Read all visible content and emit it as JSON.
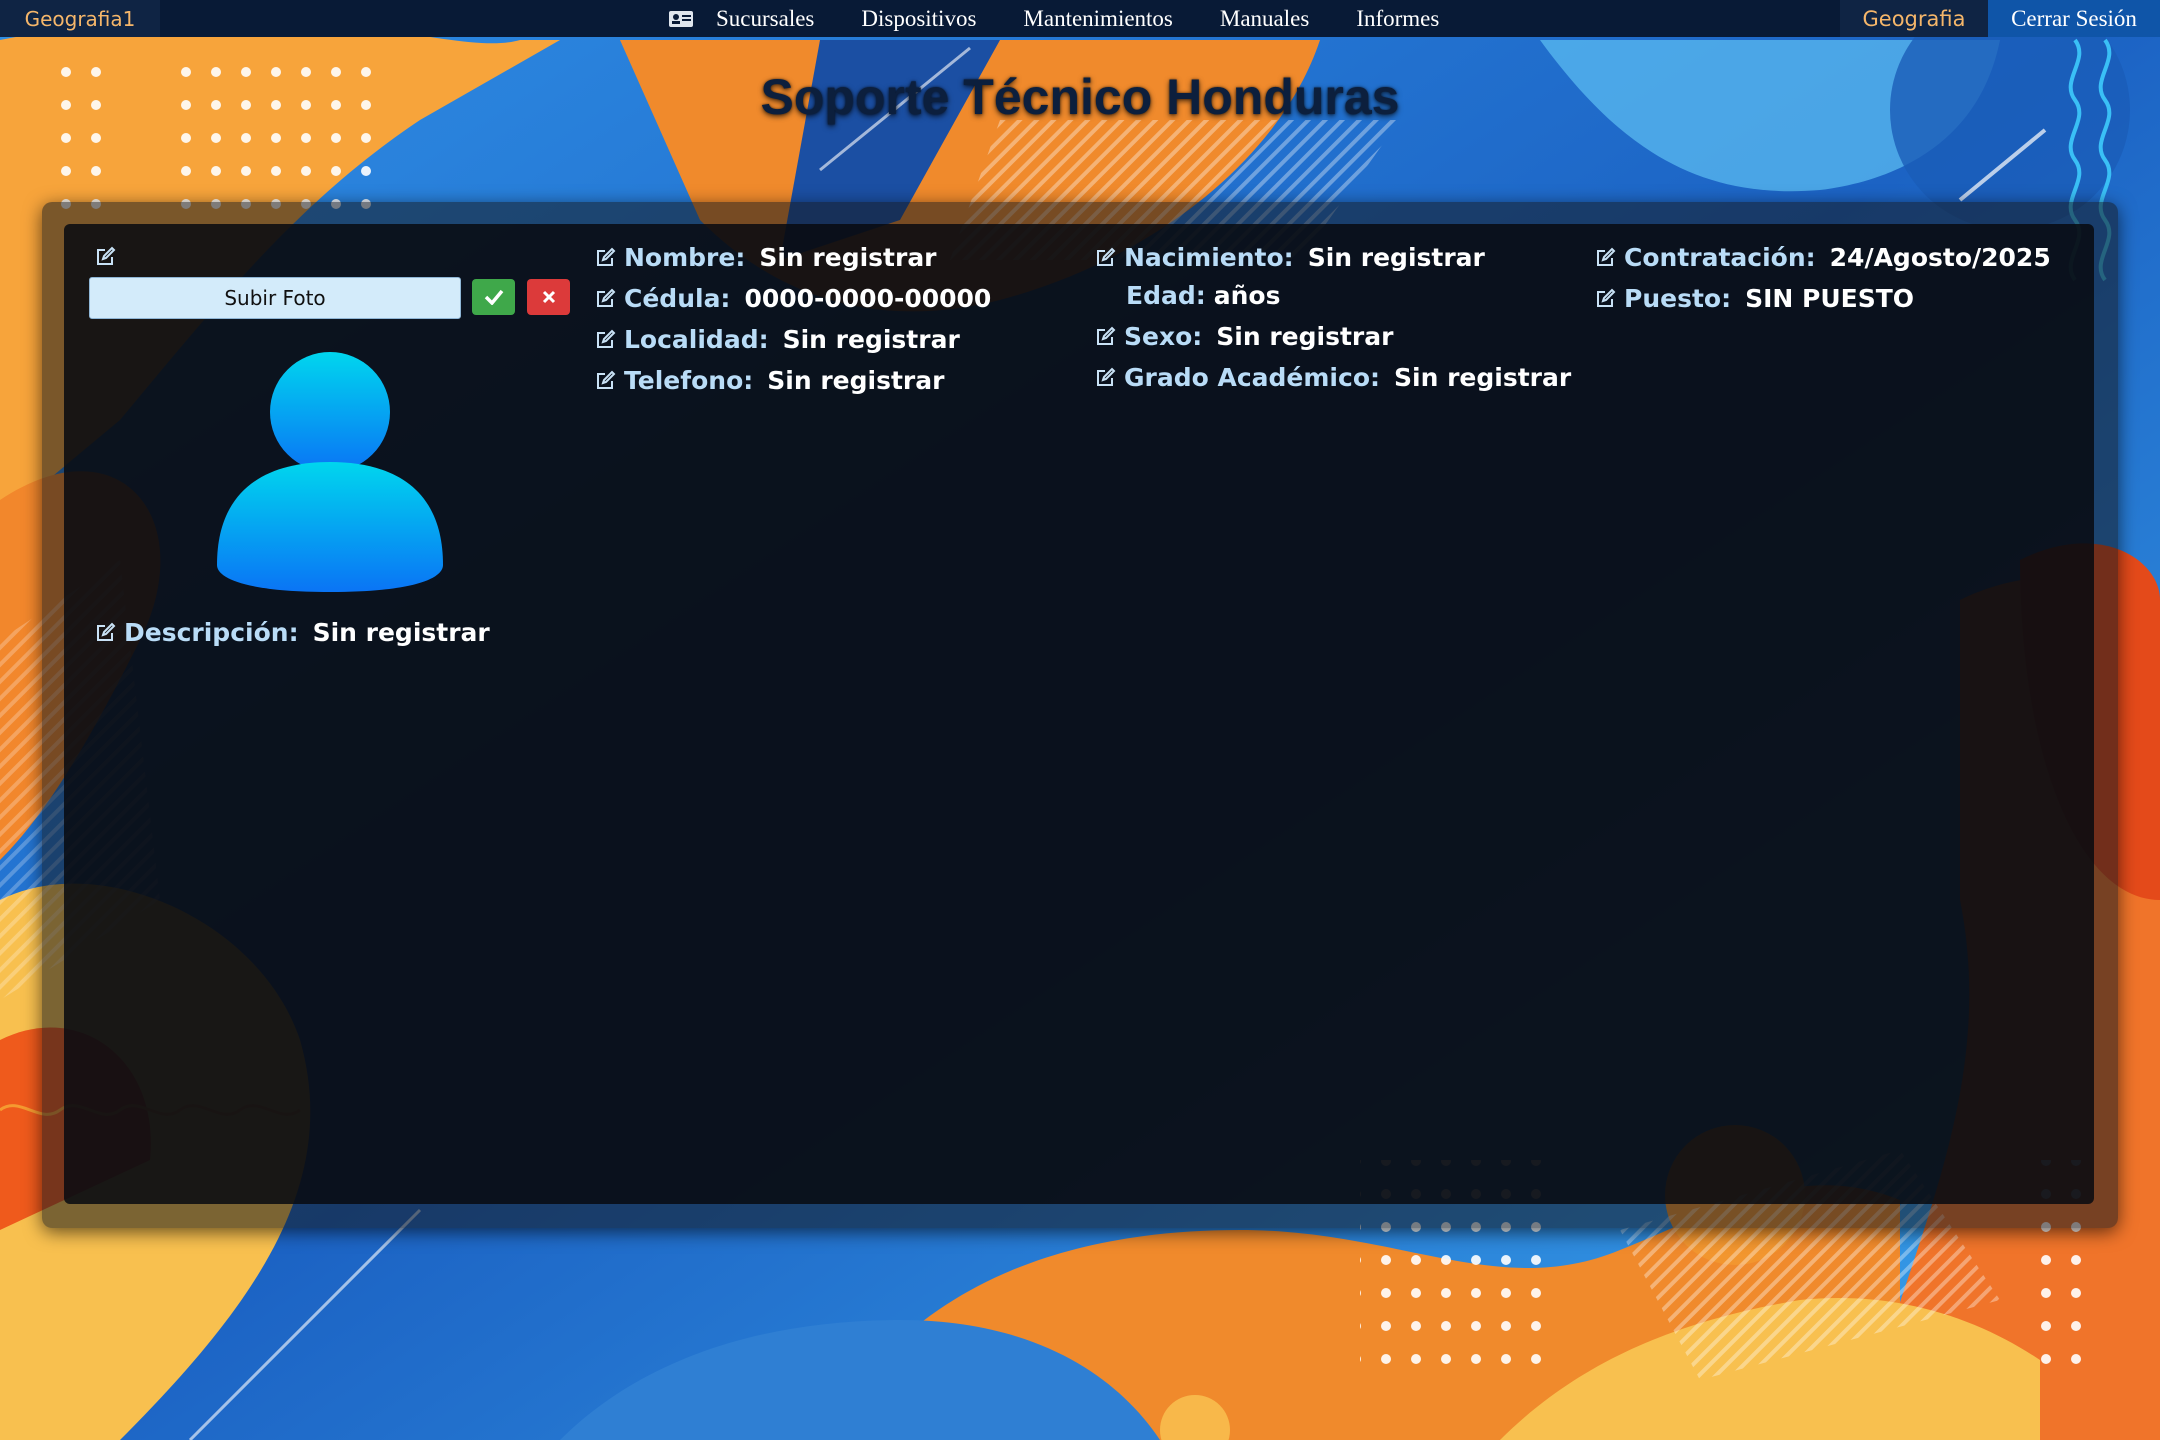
{
  "topbar": {
    "brand": "Geografia1",
    "nav_items": [
      "Sucursales",
      "Dispositivos",
      "Mantenimientos",
      "Manuales",
      "Informes"
    ],
    "user": "Geografia",
    "logout": "Cerrar Sesión"
  },
  "page_title": "Soporte Técnico Honduras",
  "photo": {
    "upload_label": "Subir Foto",
    "confirm_icon": "check-icon",
    "cancel_icon": "close-icon"
  },
  "profile": {
    "descripcion": {
      "label": "Descripción:",
      "value": "Sin registrar"
    },
    "nombre": {
      "label": "Nombre:",
      "value": "Sin registrar"
    },
    "cedula": {
      "label": "Cédula:",
      "value": "0000-0000-00000"
    },
    "localidad": {
      "label": "Localidad:",
      "value": "Sin registrar"
    },
    "telefono": {
      "label": "Telefono:",
      "value": "Sin registrar"
    },
    "nacimiento": {
      "label": "Nacimiento:",
      "value": "Sin registrar"
    },
    "edad": {
      "label": "Edad:",
      "value": "años"
    },
    "sexo": {
      "label": "Sexo:",
      "value": "Sin registrar"
    },
    "grado": {
      "label": "Grado Académico:",
      "value": "Sin registrar"
    },
    "contratacion": {
      "label": "Contratación:",
      "value": "24/Agosto/2025"
    },
    "puesto": {
      "label": "Puesto:",
      "value": "SIN PUESTO"
    }
  },
  "colors": {
    "label": "#b9dcf7",
    "accent_orange": "#f5b66a",
    "confirm": "#3fa84a",
    "cancel": "#dc3a3a"
  }
}
